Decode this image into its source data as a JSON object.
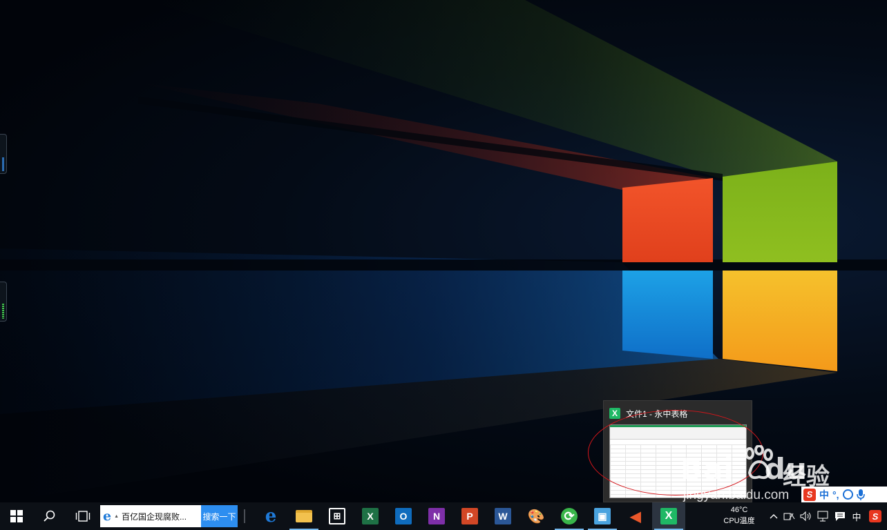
{
  "preview": {
    "title": "文件1 - 永中表格",
    "app_icon_letter": "X",
    "brand_color": "#1fb865"
  },
  "watermark": {
    "brand_text": "Bai",
    "brand_tail": "du",
    "brand_cn": "经验",
    "url": "jingyan.baidu.com"
  },
  "ime_toolbar": {
    "logo_letter": "S",
    "mode_label": "中",
    "punct_label": "°,"
  },
  "taskbar": {
    "search_box_text": "百亿国企现腐败...",
    "search_button_label": "搜索一下",
    "pinned_apps": [
      {
        "name": "edge",
        "icon": "edge-icon",
        "glyph": "e",
        "color": "#1f7ad8",
        "running": false
      },
      {
        "name": "file-explorer",
        "icon": "folder-icon",
        "glyph": "",
        "color": "#f2c14e",
        "running": true
      },
      {
        "name": "store",
        "icon": "store-icon",
        "glyph": "⊞",
        "color": "#ffffff",
        "running": false
      },
      {
        "name": "excel",
        "icon": "excel-icon",
        "glyph": "X",
        "color": "#1e7145",
        "running": false
      },
      {
        "name": "outlook",
        "icon": "outlook-icon",
        "glyph": "O",
        "color": "#0f6cbd",
        "running": false
      },
      {
        "name": "onenote",
        "icon": "onenote-icon",
        "glyph": "N",
        "color": "#7e2fa8",
        "running": false
      },
      {
        "name": "powerpoint",
        "icon": "powerpoint-icon",
        "glyph": "P",
        "color": "#d24726",
        "running": false
      },
      {
        "name": "word",
        "icon": "word-icon",
        "glyph": "W",
        "color": "#2b5797",
        "running": false
      },
      {
        "name": "paint",
        "icon": "paint-palette-icon",
        "glyph": "🎨",
        "color": "#c9a46a",
        "running": false
      },
      {
        "name": "refresh-app",
        "icon": "green-refresh-icon",
        "glyph": "⟳",
        "color": "#39b54a",
        "running": true
      },
      {
        "name": "control-panel",
        "icon": "control-panel-icon",
        "glyph": "▣",
        "color": "#4aa3df",
        "running": true
      },
      {
        "name": "media-app",
        "icon": "speaker-cone-icon",
        "glyph": "◀",
        "color": "#e9572a",
        "running": false
      },
      {
        "name": "yozo-sheet",
        "icon": "yozo-x-icon",
        "glyph": "X",
        "color": "#1fb865",
        "running": true
      }
    ],
    "cpu_temp_value": "46°C",
    "cpu_temp_label": "CPU温度",
    "tray": {
      "ime_label": "中",
      "sogou_letter": "S"
    }
  }
}
